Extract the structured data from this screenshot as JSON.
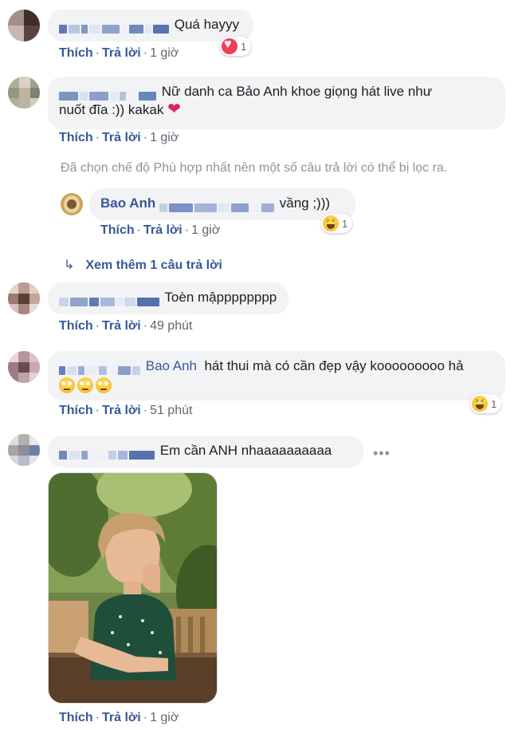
{
  "comments": [
    {
      "text": "Quá hayyy",
      "actions": {
        "like": "Thích",
        "reply": "Trả lời",
        "time": "1 giờ"
      },
      "reaction": {
        "type": "heart",
        "count": "1"
      }
    },
    {
      "text_line1": "Nữ danh ca Bảo Anh khoe giọng hát live như",
      "text_line2": "nuốt đĩa :)) kakak",
      "heart": "❤",
      "actions": {
        "like": "Thích",
        "reply": "Trả lời",
        "time": "1 giờ"
      }
    },
    {
      "text": "Toèn mậpppppppp",
      "actions": {
        "like": "Thích",
        "reply": "Trả lời",
        "time": "49 phút"
      }
    },
    {
      "tag": "Bao Anh",
      "text": "hát thui mà có cần đẹp vậy kooooooooo hả",
      "actions": {
        "like": "Thích",
        "reply": "Trả lời",
        "time": "51 phút"
      },
      "reaction": {
        "type": "haha",
        "count": "1"
      }
    },
    {
      "text": "Em cần ANH nhaaaaaaaaaa",
      "menu": "•••",
      "actions": {
        "like": "Thích",
        "reply": "Trả lời",
        "time": "1 giờ"
      }
    }
  ],
  "filter_notice": "Đã chọn chế độ Phù hợp nhất nên một số câu trả lời có thể bị lọc ra.",
  "reply": {
    "author": "Bao Anh",
    "text": "vầng ;)))",
    "actions": {
      "like": "Thích",
      "reply": "Trả lời",
      "time": "1 giờ"
    },
    "reaction": {
      "type": "haha",
      "count": "1"
    }
  },
  "more_replies": {
    "arrow": "↳",
    "label": "Xem thêm 1 câu trả lời"
  },
  "colors": {
    "link": "#385898",
    "bubble": "#f2f3f5",
    "muted": "#606770",
    "notice": "#8d949e"
  }
}
